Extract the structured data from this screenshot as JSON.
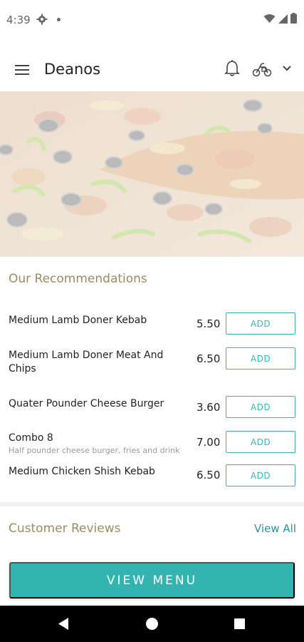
{
  "status_bar": {
    "time": "4:39"
  },
  "app_bar": {
    "title": "Deanos"
  },
  "hero": {
    "image": "pizza-photo"
  },
  "recommendations": {
    "title": "Our Recommendations",
    "add_label": "ADD",
    "items": [
      {
        "name": "Medium Lamb Doner Kebab",
        "desc": "",
        "price": "5.50"
      },
      {
        "name": "Medium Lamb Doner Meat And Chips",
        "desc": "",
        "price": "6.50"
      },
      {
        "name": "Quater Pounder Cheese Burger",
        "desc": "",
        "price": "3.60"
      },
      {
        "name": "Combo 8",
        "desc": "Half pounder cheese burger, fries and drink",
        "price": "7.00"
      },
      {
        "name": "Medium Chicken Shish Kebab",
        "desc": "",
        "price": "6.50"
      }
    ]
  },
  "reviews": {
    "title": "Customer Reviews",
    "view_all": "View All"
  },
  "cta": {
    "label": "VIEW MENU"
  },
  "colors": {
    "accent": "#34b4b0",
    "section_title": "#9a8c63",
    "link": "#2e8fa3"
  }
}
